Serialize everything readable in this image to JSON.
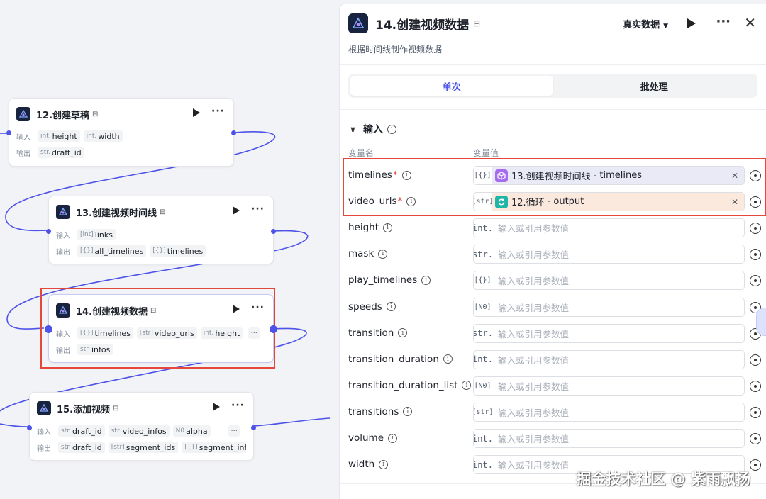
{
  "canvas": {
    "nodes": [
      {
        "id": "n12",
        "title": "12.创建草稿",
        "in_label": "输入",
        "out_label": "输出",
        "inputs": [
          {
            "type": "int.",
            "name": "height"
          },
          {
            "type": "int.",
            "name": "width"
          }
        ],
        "outputs": [
          {
            "type": "str.",
            "name": "draft_id"
          }
        ]
      },
      {
        "id": "n13",
        "title": "13.创建视频时间线",
        "in_label": "输入",
        "out_label": "输出",
        "inputs": [
          {
            "type": "[int]",
            "name": "links"
          }
        ],
        "outputs": [
          {
            "type": "[{}]",
            "name": "all_timelines"
          },
          {
            "type": "[{}]",
            "name": "timelines"
          }
        ]
      },
      {
        "id": "n14",
        "title": "14.创建视频数据",
        "in_label": "输入",
        "out_label": "输出",
        "inputs": [
          {
            "type": "[{}]",
            "name": "timelines"
          },
          {
            "type": "[str]",
            "name": "video_urls"
          },
          {
            "type": "int.",
            "name": "height"
          }
        ],
        "outputs": [
          {
            "type": "str.",
            "name": "infos"
          }
        ]
      },
      {
        "id": "n15",
        "title": "15.添加视频",
        "in_label": "输入",
        "out_label": "输出",
        "inputs": [
          {
            "type": "str.",
            "name": "draft_id"
          },
          {
            "type": "str.",
            "name": "video_infos"
          },
          {
            "type": "N0",
            "name": "alpha"
          }
        ],
        "outputs": [
          {
            "type": "str.",
            "name": "draft_id"
          },
          {
            "type": "[str]",
            "name": "segment_ids"
          },
          {
            "type": "[{}]",
            "name": "segment_infos"
          }
        ]
      }
    ],
    "more_chip": "···"
  },
  "panel": {
    "title": "14.创建视频数据",
    "description": "根据时间线制作视频数据",
    "mode": "真实数据",
    "tabs": [
      "单次",
      "批处理"
    ],
    "active_tab": 0,
    "section_title": "输入",
    "col_name": "变量名",
    "col_value": "变量值",
    "placeholder": "输入或引用参数值",
    "params": [
      {
        "name": "timelines",
        "required": true,
        "type": "[{}]",
        "ref": {
          "node": "13.创建视频时间线",
          "field": "timelines",
          "color": "purple"
        }
      },
      {
        "name": "video_urls",
        "required": true,
        "type": "[str]",
        "ref": {
          "node": "12.循环",
          "field": "output",
          "color": "orange"
        }
      },
      {
        "name": "height",
        "required": false,
        "type": "int."
      },
      {
        "name": "mask",
        "required": false,
        "type": "str."
      },
      {
        "name": "play_timelines",
        "required": false,
        "type": "[{}]"
      },
      {
        "name": "speeds",
        "required": false,
        "type": "[N0]"
      },
      {
        "name": "transition",
        "required": false,
        "type": "str."
      },
      {
        "name": "transition_duration",
        "required": false,
        "type": "int."
      },
      {
        "name": "transition_duration_list",
        "required": false,
        "type": "[N0]"
      },
      {
        "name": "transitions",
        "required": false,
        "type": "[str]"
      },
      {
        "name": "volume",
        "required": false,
        "type": "int."
      },
      {
        "name": "width",
        "required": false,
        "type": "int."
      }
    ]
  },
  "watermark": "掘金技术社区 @ 紫雨飘扬",
  "colors": {
    "accent": "#4d53e8",
    "highlight": "#e5473b",
    "ref_purple": "#a66cf0",
    "ref_teal": "#20b5a9"
  }
}
